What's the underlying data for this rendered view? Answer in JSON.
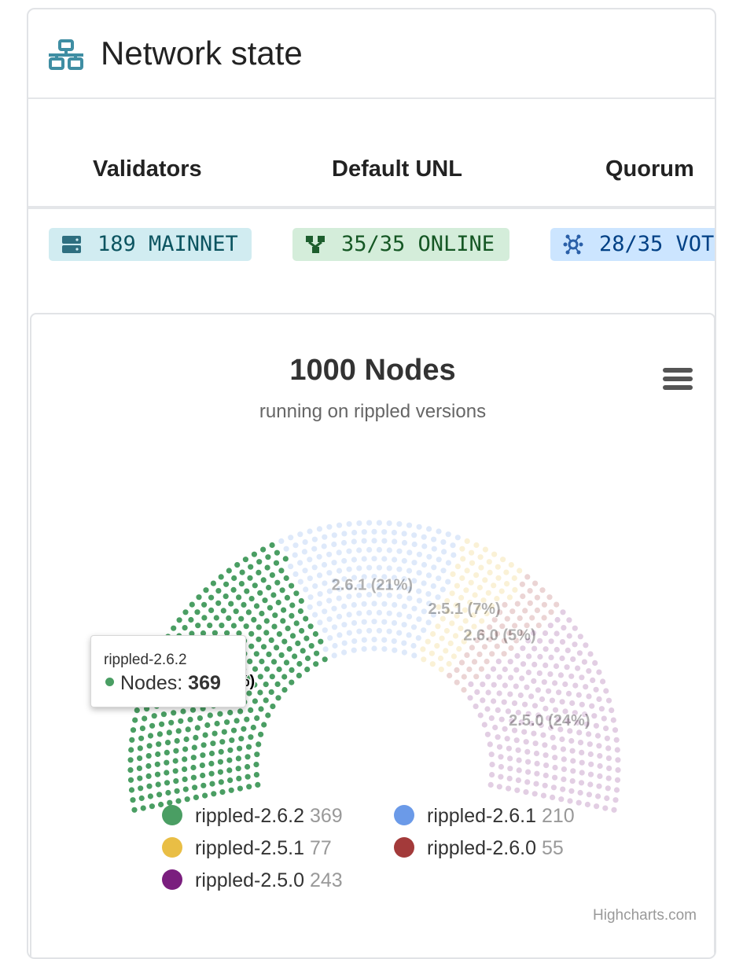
{
  "header": {
    "title": "Network state",
    "icon": "network-icon"
  },
  "tabs": [
    {
      "label": "Validators"
    },
    {
      "label": "Default UNL"
    },
    {
      "label": "Quorum"
    }
  ],
  "badges": [
    {
      "text": "189 MAINNET",
      "icon": "server-icon",
      "bg": "#d1ecf1",
      "fg": "#0c5460"
    },
    {
      "text": "35/35 ONLINE",
      "icon": "sitemap-icon",
      "bg": "#d4edda",
      "fg": "#155724"
    },
    {
      "text": "28/35 VOT",
      "icon": "hub-icon",
      "bg": "#cce5ff",
      "fg": "#004085"
    }
  ],
  "chart": {
    "menu_icon": "hamburger-menu-icon",
    "credits": "Highcharts.com",
    "tooltip": {
      "title": "rippled-2.6.2",
      "label": "Nodes:",
      "value": "369"
    }
  },
  "chart_data": {
    "type": "item",
    "title": "1000 Nodes",
    "subtitle": "running on rippled versions",
    "series": [
      {
        "name": "rippled-2.6.2",
        "short": "2.6.2",
        "value": 369,
        "pct": "36%",
        "color": "#4a9e63",
        "highlighted": true
      },
      {
        "name": "rippled-2.6.1",
        "short": "2.6.1",
        "value": 210,
        "pct": "21%",
        "color": "#6b9ae8",
        "highlighted": false
      },
      {
        "name": "rippled-2.5.1",
        "short": "2.5.1",
        "value": 77,
        "pct": "7%",
        "color": "#e9be45",
        "highlighted": false
      },
      {
        "name": "rippled-2.6.0",
        "short": "2.6.0",
        "value": 55,
        "pct": "5%",
        "color": "#a33a3a",
        "highlighted": false
      },
      {
        "name": "rippled-2.5.0",
        "short": "2.5.0",
        "value": 243,
        "pct": "24%",
        "color": "#7a1e7e",
        "highlighted": false
      }
    ],
    "data_labels": [
      {
        "series": "2.6.2",
        "text": "2.6.2 (36%)"
      },
      {
        "series": "2.6.1",
        "text": "2.6.1 (21%)"
      },
      {
        "series": "2.5.1",
        "text": "2.5.1 (7%)"
      },
      {
        "series": "2.6.0",
        "text": "2.6.0 (5%)"
      },
      {
        "series": "2.5.0",
        "text": "2.5.0 (24%)"
      }
    ],
    "legend": [
      {
        "name": "rippled-2.6.2",
        "count": "369",
        "color": "#4a9e63"
      },
      {
        "name": "rippled-2.6.1",
        "count": "210",
        "color": "#6b9ae8"
      },
      {
        "name": "rippled-2.5.1",
        "count": "77",
        "color": "#e9be45"
      },
      {
        "name": "rippled-2.6.0",
        "count": "55",
        "color": "#a33a3a"
      },
      {
        "name": "rippled-2.5.0",
        "count": "243",
        "color": "#7a1e7e"
      }
    ]
  }
}
